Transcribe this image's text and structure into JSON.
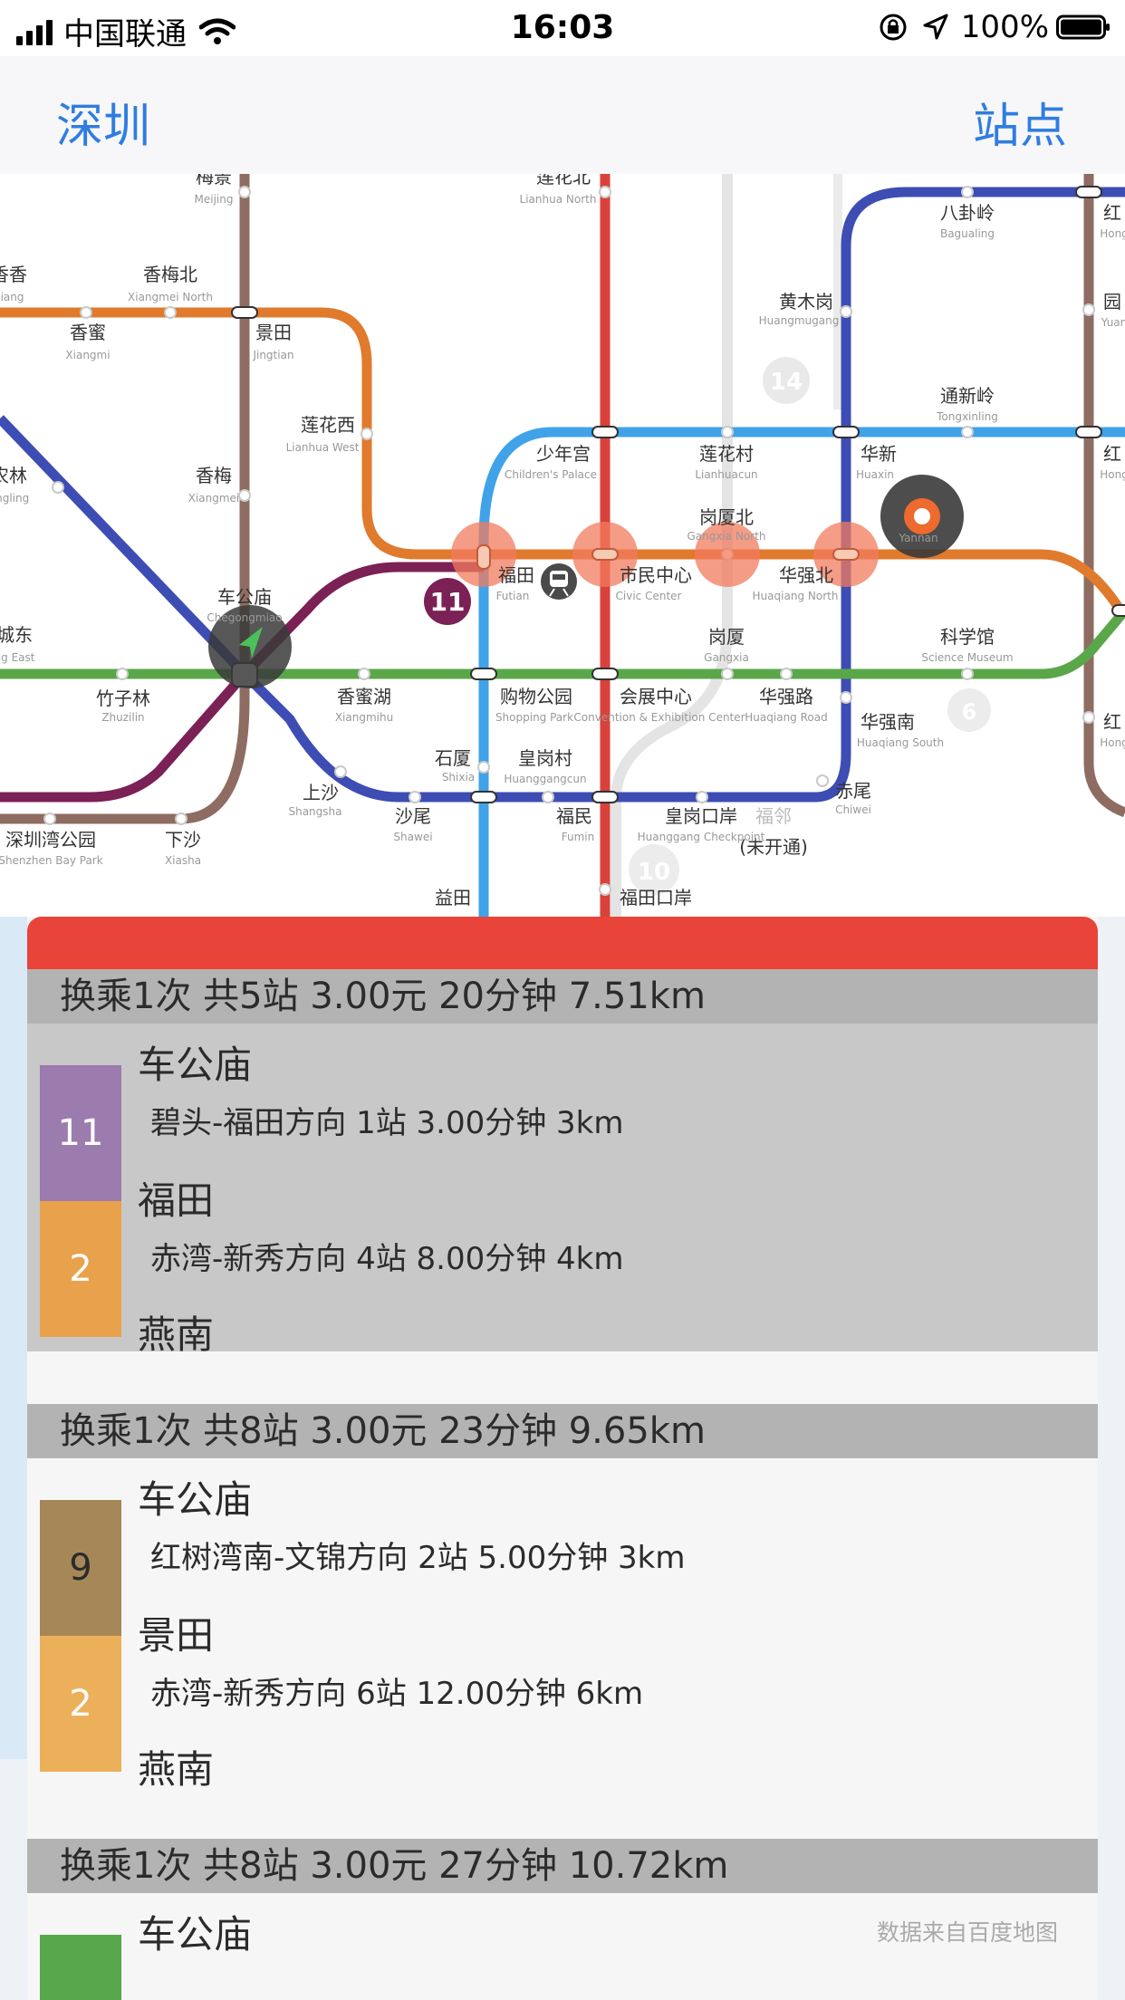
{
  "status_bar": {
    "carrier": "中国联通",
    "time": "16:03",
    "battery": "100%",
    "icons": [
      "signal-icon",
      "wifi-icon",
      "orientation-lock-icon",
      "location-arrow-icon",
      "battery-icon"
    ]
  },
  "nav": {
    "city": "深圳",
    "stations": "站点"
  },
  "map": {
    "stations": {
      "meijing": {
        "zh": "梅景",
        "en": "Meijing"
      },
      "xiangxiang": {
        "zh": "香香",
        "en": "xiang"
      },
      "xiangmeibei": {
        "zh": "香梅北",
        "en": "Xiangmei North"
      },
      "xiangmi": {
        "zh": "香蜜",
        "en": "Xiangmi"
      },
      "jingtian": {
        "zh": "景田",
        "en": "Jingtian"
      },
      "lianhuaxi": {
        "zh": "莲花西",
        "en": "Lianhua West"
      },
      "xiangmei": {
        "zh": "香梅",
        "en": "Xiangmei"
      },
      "nonglin": {
        "zh": "农林",
        "en": "ongling"
      },
      "chegongmiao": {
        "zh": "车公庙",
        "en": "Chegongmiao"
      },
      "chengdong": {
        "zh": "城东",
        "en": "ng East"
      },
      "zhuzilin": {
        "zh": "竹子林",
        "en": "Zhuzilin"
      },
      "xiangmihu": {
        "zh": "香蜜湖",
        "en": "Xiangmihu"
      },
      "shenzhenwan": {
        "zh": "深圳湾公园",
        "en": "Shenzhen Bay Park"
      },
      "xiasha": {
        "zh": "下沙",
        "en": "Xiasha"
      },
      "shangsha": {
        "zh": "上沙",
        "en": "Shangsha"
      },
      "shawei": {
        "zh": "沙尾",
        "en": "Shawei"
      },
      "lianhuabei": {
        "zh": "莲花北",
        "en": "Lianhua North"
      },
      "shaoniangong": {
        "zh": "少年宫",
        "en": "Children's Palace"
      },
      "futian": {
        "zh": "福田",
        "en": "Futian"
      },
      "gouwugongyuan": {
        "zh": "购物公园",
        "en": "Shopping Park"
      },
      "shixia": {
        "zh": "石厦",
        "en": "Shixia"
      },
      "yitian": {
        "zh": "益田",
        "en": ""
      },
      "shiminzhongxin": {
        "zh": "市民中心",
        "en": "Civic Center"
      },
      "huizhan": {
        "zh": "会展中心",
        "en": "Convention & Exhibition Center"
      },
      "huanggangcun": {
        "zh": "皇岗村",
        "en": "Huanggangcun"
      },
      "fumin": {
        "zh": "福民",
        "en": "Fumin"
      },
      "futiankouan": {
        "zh": "福田口岸",
        "en": ""
      },
      "lianhuacun": {
        "zh": "莲花村",
        "en": "Lianhuacun"
      },
      "gangxiabei": {
        "zh": "岗厦北",
        "en": "Gangxia North"
      },
      "gangxia": {
        "zh": "岗厦",
        "en": "Gangxia"
      },
      "huanggangkouan": {
        "zh": "皇岗口岸",
        "en": "Huanggang Checkpoint"
      },
      "fulin": {
        "zh": "福邻",
        "en": "Fulin"
      },
      "weikaitong": {
        "zh": "(未开通)",
        "en": ""
      },
      "huangmugang": {
        "zh": "黄木岗",
        "en": "Huangmugang"
      },
      "bagualing": {
        "zh": "八卦岭",
        "en": "Bagualing"
      },
      "tongxinling": {
        "zh": "通新岭",
        "en": "Tongxinling"
      },
      "huaxin": {
        "zh": "华新",
        "en": "Huaxin"
      },
      "huaqiangbei": {
        "zh": "华强北",
        "en": "Huaqiang North"
      },
      "huaqianglu": {
        "zh": "华强路",
        "en": "Huaqiang Road"
      },
      "huaqiangnan": {
        "zh": "华强南",
        "en": "Huaqiang South"
      },
      "chiwei": {
        "zh": "赤尾",
        "en": "Chiwei"
      },
      "kexueguan": {
        "zh": "科学馆",
        "en": "Science Museum"
      },
      "yanlan": {
        "zh": "",
        "en": "Yannan"
      },
      "hong1": {
        "zh": "红",
        "en": "Hong"
      },
      "yuan": {
        "zh": "园",
        "en": "Yuan"
      },
      "hong2": {
        "zh": "红",
        "en": "Hong"
      },
      "hong3": {
        "zh": "红",
        "en": "Hong"
      }
    },
    "badges": {
      "line11": "11",
      "line14": "14",
      "line6": "6",
      "line10": "10"
    },
    "colors": {
      "line1": "#5aa74a",
      "line2": "#e07a2c",
      "line3": "#40a2e8",
      "line4": "#d9413a",
      "line7": "#3e4db3",
      "line9": "#8e6c61",
      "line11": "#7b2155",
      "line14": "#d5d5d5"
    }
  },
  "routes": [
    {
      "summary": "换乘1次 共5站 3.00元 20分钟 7.51km",
      "stations": [
        "车公庙",
        "福田",
        "燕南"
      ],
      "legs": [
        {
          "line": "11",
          "color": "#9c7bae",
          "desc": "碧头-福田方向 1站 3.00分钟 3km"
        },
        {
          "line": "2",
          "color": "#e8a24c",
          "desc": "赤湾-新秀方向 4站 8.00分钟 4km"
        }
      ]
    },
    {
      "summary": "换乘1次 共8站 3.00元 23分钟 9.65km",
      "stations": [
        "车公庙",
        "景田",
        "燕南"
      ],
      "legs": [
        {
          "line": "9",
          "color": "#a68758",
          "desc": "红树湾南-文锦方向 2站 5.00分钟 3km"
        },
        {
          "line": "2",
          "color": "#edb05a",
          "desc": "赤湾-新秀方向 6站 12.00分钟 6km"
        }
      ]
    },
    {
      "summary": "换乘1次 共8站 3.00元 27分钟 10.72km",
      "stations": [
        "车公庙"
      ],
      "legs": [
        {
          "line": "",
          "color": "#56a84a",
          "desc": ""
        }
      ]
    }
  ],
  "credit": "数据来自百度地图"
}
